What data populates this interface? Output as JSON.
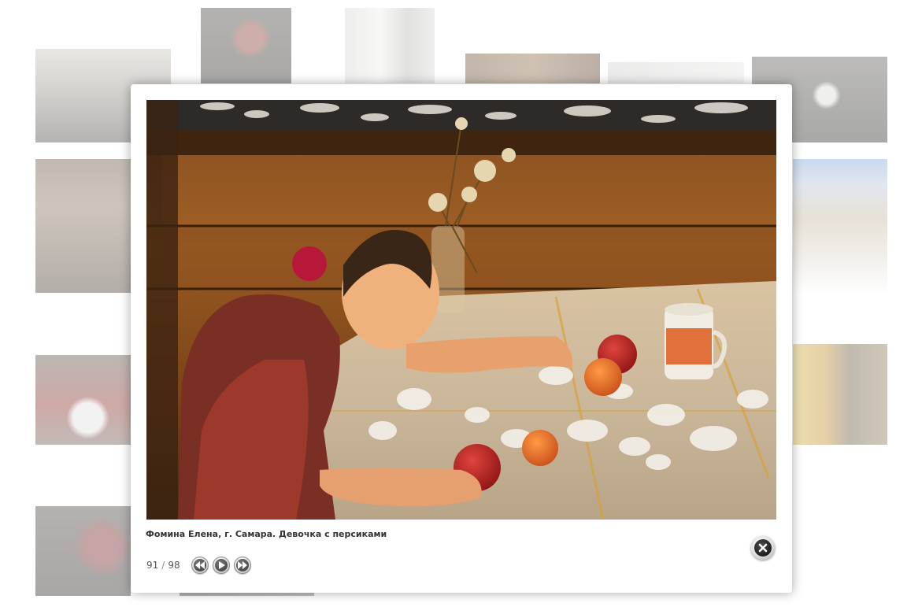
{
  "lightbox": {
    "caption": "Фомина Елена, г. Самара. Девочка с персиками",
    "counter": {
      "current": "91",
      "separator": "/",
      "total": "98"
    },
    "nav": {
      "prev_icon": "rewind-icon",
      "play_icon": "play-icon",
      "next_icon": "fast-forward-icon"
    },
    "close_icon": "close-icon"
  },
  "colors": {
    "panel": "#ffffff",
    "caption_text": "#333333",
    "counter_text": "#555555",
    "backdrop": "#ffffff"
  }
}
